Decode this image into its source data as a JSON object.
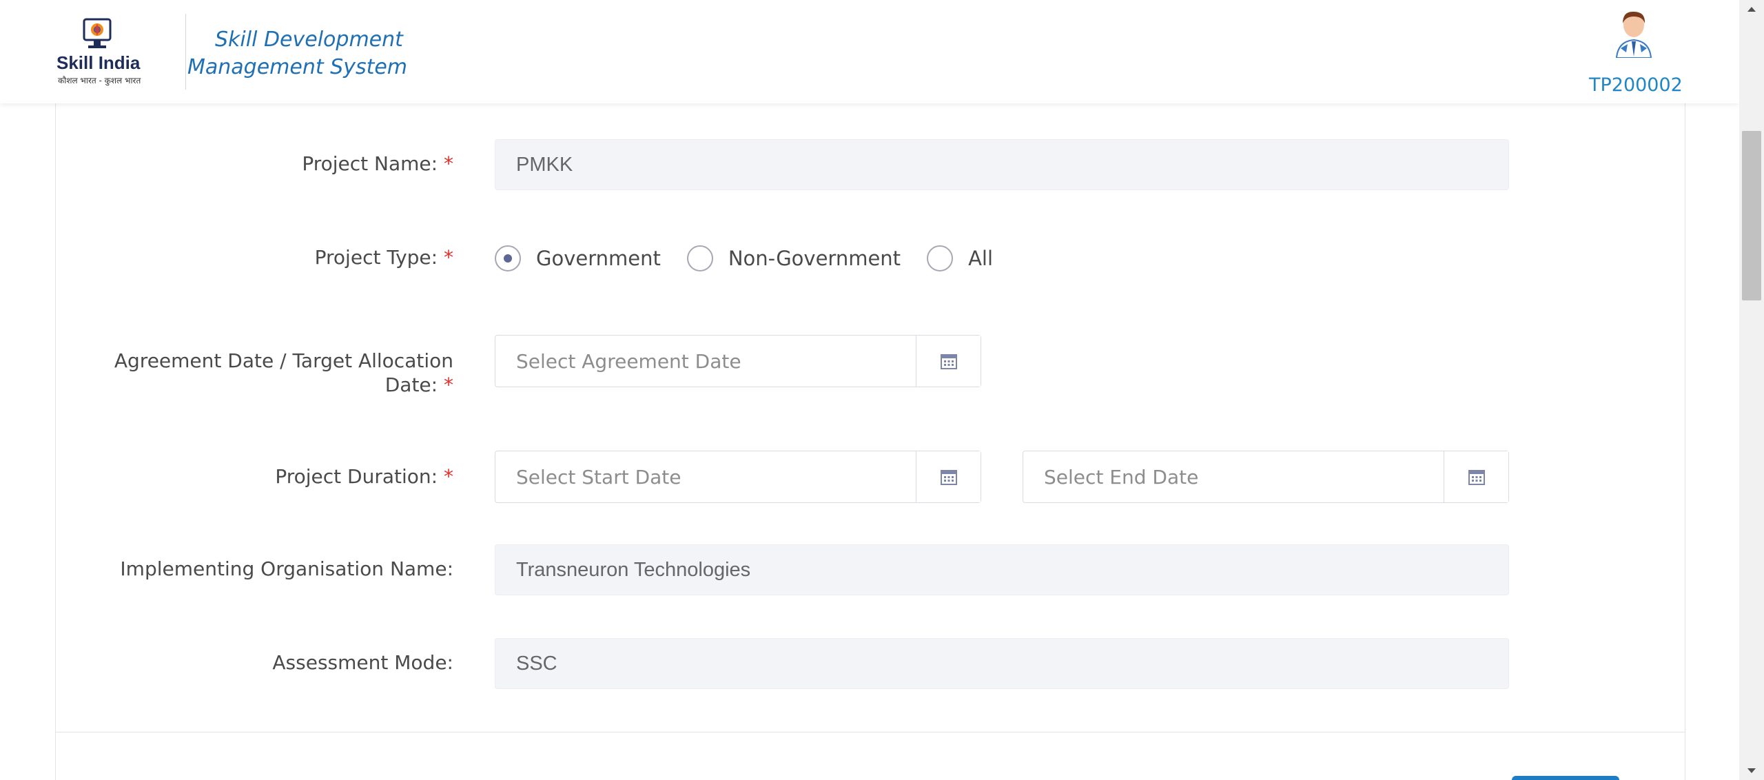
{
  "header": {
    "brand": "Skill India",
    "brand_tagline": "कौशल भारत - कुशल भारत",
    "app_title": "Skill Development Management System",
    "user_id": "TP200002"
  },
  "form": {
    "project_name": {
      "label": "Project Name:",
      "required_mark": "*",
      "value": "PMKK"
    },
    "project_type": {
      "label": "Project Type:",
      "required_mark": "*",
      "options": [
        "Government",
        "Non-Government",
        "All"
      ],
      "selected": "Government"
    },
    "agreement_date": {
      "label_line1": "Agreement Date / Target Allocation",
      "label_line2": "Date:",
      "required_mark": "*",
      "placeholder": "Select Agreement Date"
    },
    "project_duration": {
      "label": "Project Duration:",
      "required_mark": "*",
      "start_placeholder": "Select Start Date",
      "end_placeholder": "Select End Date"
    },
    "implementing_org": {
      "label": "Implementing Organisation Name:",
      "value": "Transneuron Technologies"
    },
    "assessment_mode": {
      "label": "Assessment Mode:",
      "value": "SSC"
    }
  },
  "colors": {
    "accent": "#1f6fb5",
    "required": "#e0312b",
    "readonly_bg": "#f3f4f8"
  },
  "icons": {
    "calendar": "calendar-icon",
    "scroll_up": "scroll-up-arrow-icon",
    "scroll_down": "scroll-down-arrow-icon"
  }
}
